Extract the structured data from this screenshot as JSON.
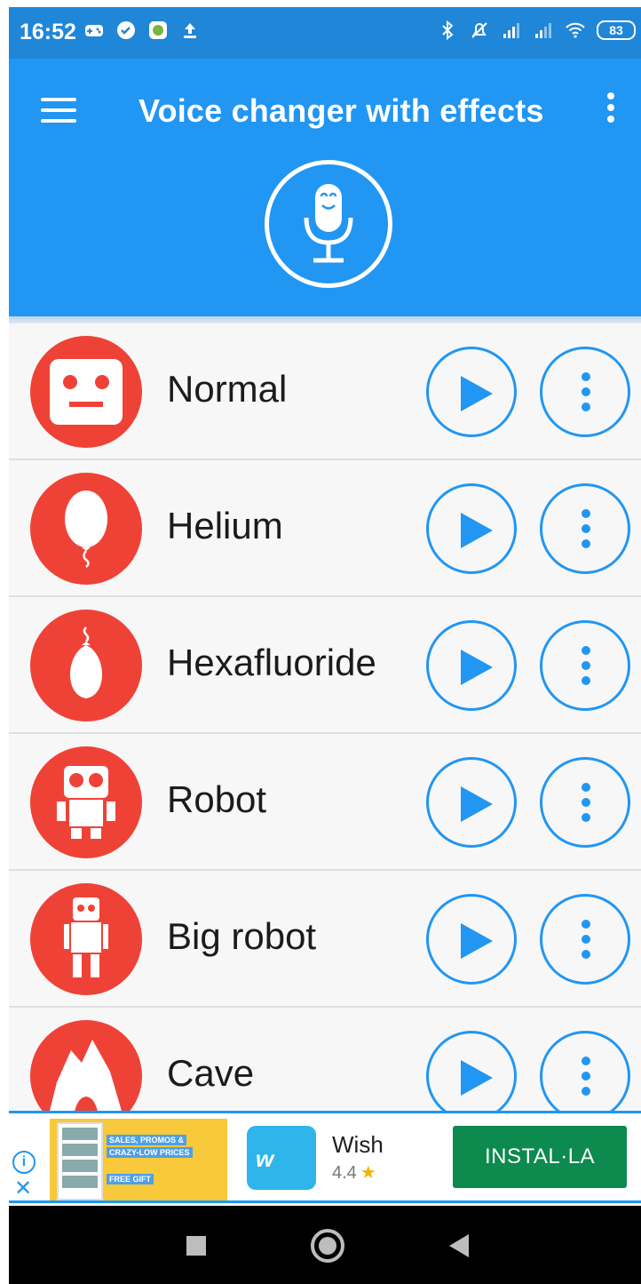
{
  "status_bar": {
    "time": "16:52",
    "battery": "83",
    "icons_left": [
      "gamepad-icon",
      "check-circle-icon",
      "app-notification-icon",
      "upload-icon"
    ],
    "icons_right": [
      "bluetooth-icon",
      "mute-icon",
      "signal-icon",
      "signal-icon",
      "wifi-icon",
      "battery-icon"
    ]
  },
  "app_bar": {
    "title": "Voice changer with effects",
    "menu_icon": "hamburger-menu-icon",
    "overflow_icon": "more-vert-icon",
    "mic_icon": "microphone-icon"
  },
  "effects": [
    {
      "label": "Normal",
      "icon": "robot-face-icon"
    },
    {
      "label": "Helium",
      "icon": "balloon-icon"
    },
    {
      "label": "Hexafluoride",
      "icon": "heavy-balloon-icon"
    },
    {
      "label": "Robot",
      "icon": "robot-icon"
    },
    {
      "label": "Big robot",
      "icon": "big-robot-icon"
    },
    {
      "label": "Cave",
      "icon": "cave-icon"
    }
  ],
  "ad": {
    "image_text": [
      "SALES, PROMOS &",
      "CRAZY-LOW PRICES",
      "FREE GIFT"
    ],
    "logo_text": "w",
    "app_name": "Wish",
    "rating": "4.4",
    "install_label": "INSTAL·LA"
  },
  "colors": {
    "status_bar": "#1f86d8",
    "app_bar": "#2196f3",
    "effect_icon_bg": "#ef4237",
    "accent": "#2196f3",
    "install_button": "#0d8a4e"
  }
}
